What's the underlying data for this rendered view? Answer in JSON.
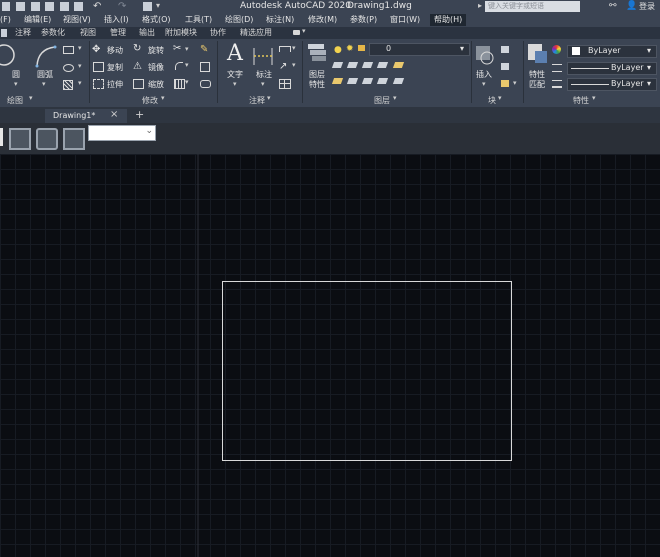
{
  "title_bar": {
    "app_title": "Autodesk AutoCAD 2020",
    "drawing_name": "Drawing1.dwg",
    "search_placeholder": "键入关键字或短语",
    "login_label": "登录"
  },
  "menu": [
    {
      "label": "(F)"
    },
    {
      "label": "编辑(E)"
    },
    {
      "label": "视图(V)"
    },
    {
      "label": "插入(I)"
    },
    {
      "label": "格式(O)"
    },
    {
      "label": "工具(T)"
    },
    {
      "label": "绘图(D)"
    },
    {
      "label": "标注(N)"
    },
    {
      "label": "修改(M)"
    },
    {
      "label": "参数(P)"
    },
    {
      "label": "窗口(W)"
    },
    {
      "label": "帮助(H)"
    }
  ],
  "ribbon_tabs": [
    {
      "label": "注释"
    },
    {
      "label": "参数化"
    },
    {
      "label": "视图"
    },
    {
      "label": "管理"
    },
    {
      "label": "输出"
    },
    {
      "label": "附加模块"
    },
    {
      "label": "协作"
    },
    {
      "label": "精选应用"
    }
  ],
  "draw_panel": {
    "circle_label": "圆",
    "arc_label": "圆弧",
    "title": "绘图"
  },
  "modify_panel": {
    "move": "移动",
    "rotate": "旋转",
    "copy": "复制",
    "mirror": "镜像",
    "stretch": "拉伸",
    "scale": "缩放",
    "title": "修改"
  },
  "annotation_panel": {
    "text": "文字",
    "dimension": "标注",
    "title": "注释"
  },
  "layers_panel": {
    "layer_properties_line1": "图层",
    "layer_properties_line2": "特性",
    "current_layer": "0",
    "title": "图层"
  },
  "block_panel": {
    "insert": "插入",
    "title": "块"
  },
  "properties_panel": {
    "match_line1": "特性",
    "match_line2": "匹配",
    "color": "ByLayer",
    "linetype": "ByLayer",
    "lineweight": "ByLayer",
    "title": "特性"
  },
  "document_tabs": {
    "active": "Drawing1*",
    "close_symbol": "×",
    "new_tab_symbol": "+"
  }
}
